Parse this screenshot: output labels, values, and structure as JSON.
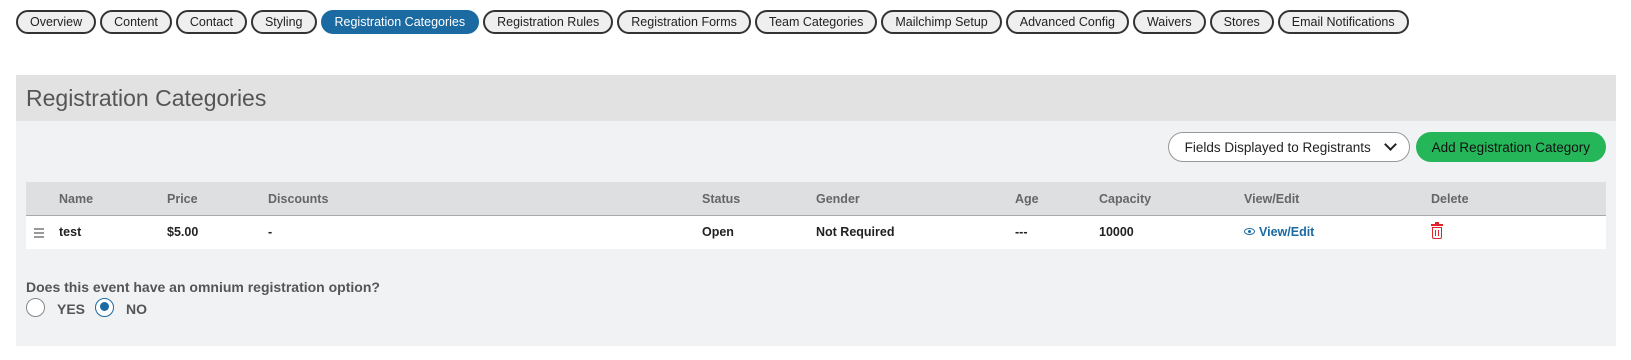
{
  "tabs": [
    {
      "label": "Overview"
    },
    {
      "label": "Content"
    },
    {
      "label": "Contact"
    },
    {
      "label": "Styling"
    },
    {
      "label": "Registration Categories",
      "active": true
    },
    {
      "label": "Registration Rules"
    },
    {
      "label": "Registration Forms"
    },
    {
      "label": "Team Categories"
    },
    {
      "label": "Mailchimp Setup"
    },
    {
      "label": "Advanced Config"
    },
    {
      "label": "Waivers"
    },
    {
      "label": "Stores"
    },
    {
      "label": "Email Notifications"
    }
  ],
  "panel": {
    "title": "Registration Categories",
    "fields_select": {
      "value": "Fields Displayed to Registrants",
      "icon": "chevron-down-icon"
    },
    "add_button": "Add Registration Category"
  },
  "table": {
    "headers": {
      "name": "Name",
      "price": "Price",
      "discounts": "Discounts",
      "status": "Status",
      "gender": "Gender",
      "age": "Age",
      "capacity": "Capacity",
      "view_edit": "View/Edit",
      "delete": "Delete"
    },
    "rows": [
      {
        "name": "test",
        "price": "$5.00",
        "discounts": "-",
        "status": "Open",
        "gender": "Not Required",
        "age": "---",
        "capacity": "10000",
        "view_edit": "View/Edit"
      }
    ]
  },
  "omnium": {
    "question": "Does this event have an omnium registration option?",
    "yes_label": "YES",
    "no_label": "NO",
    "selected": "NO"
  },
  "colors": {
    "accent": "#1b6aa2",
    "add_button": "#25b65a",
    "delete_icon": "#e0242b",
    "panel_bg": "#f1f2f4",
    "header_bg": "#e2e2e3"
  }
}
